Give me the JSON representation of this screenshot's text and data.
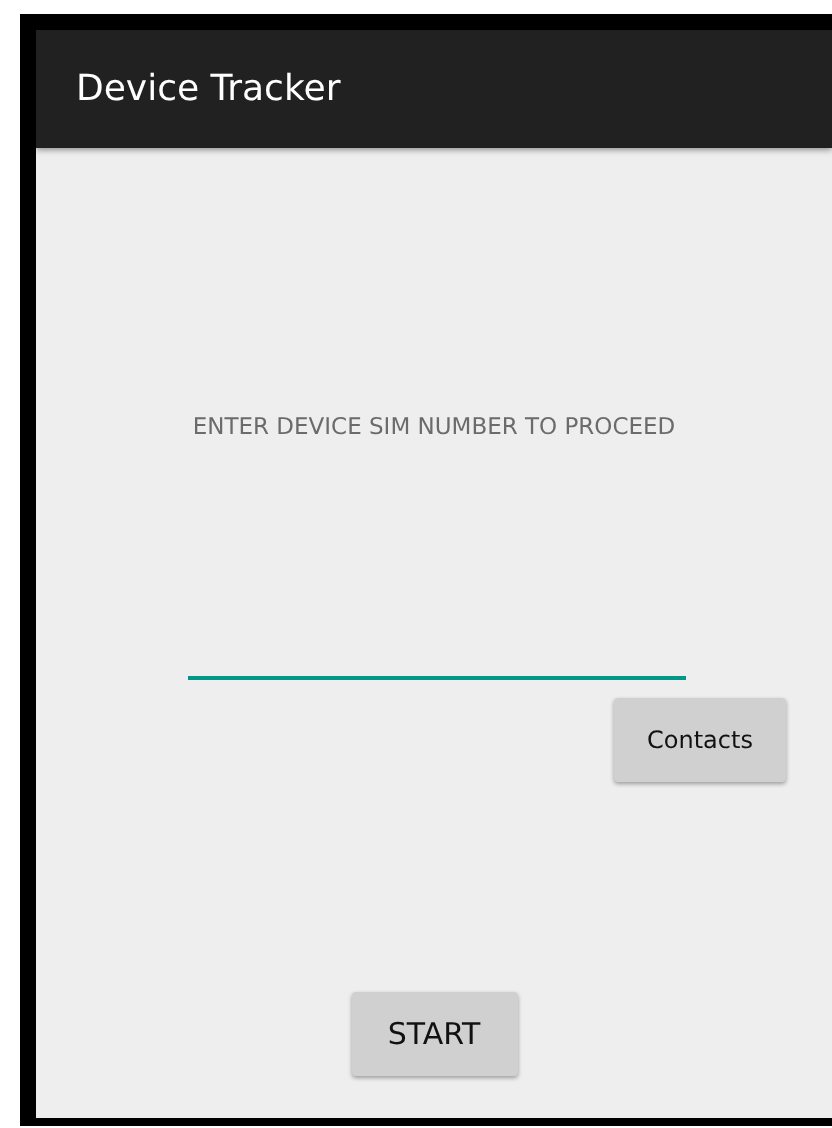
{
  "app_bar": {
    "title": "Device Tracker"
  },
  "prompt": "ENTER DEVICE SIM NUMBER TO PROCEED",
  "sim_field": {
    "focused": true
  },
  "buttons": [
    {
      "kind": "contacts",
      "label": "Contacts"
    },
    {
      "kind": "start",
      "label": "START"
    }
  ]
}
